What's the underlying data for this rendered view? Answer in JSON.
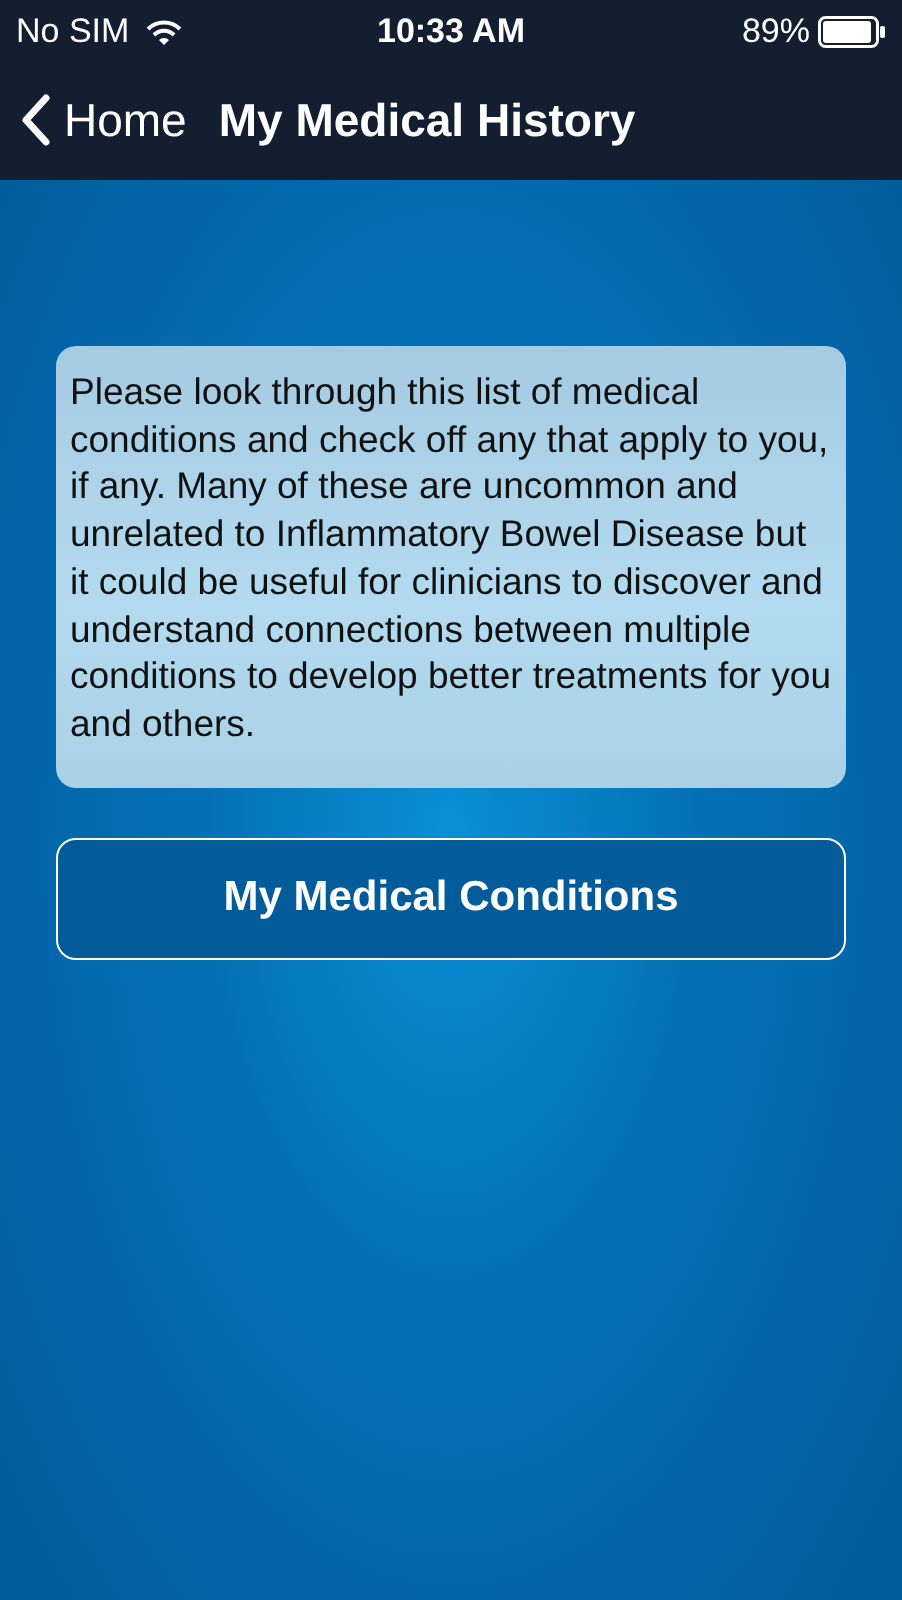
{
  "status_bar": {
    "carrier": "No SIM",
    "time": "10:33 AM",
    "battery": "89%"
  },
  "nav_bar": {
    "back_label": "Home",
    "title": "My Medical History"
  },
  "info_text": "Please look through this list of medical conditions and check off any that apply to you, if any. Many of these are uncommon and unrelated to Inflammatory Bowel Disease but it could be useful for clinicians to discover and understand connections between multiple conditions to develop better treatments for you and others.",
  "buttons": [
    "My Medical Conditions"
  ]
}
